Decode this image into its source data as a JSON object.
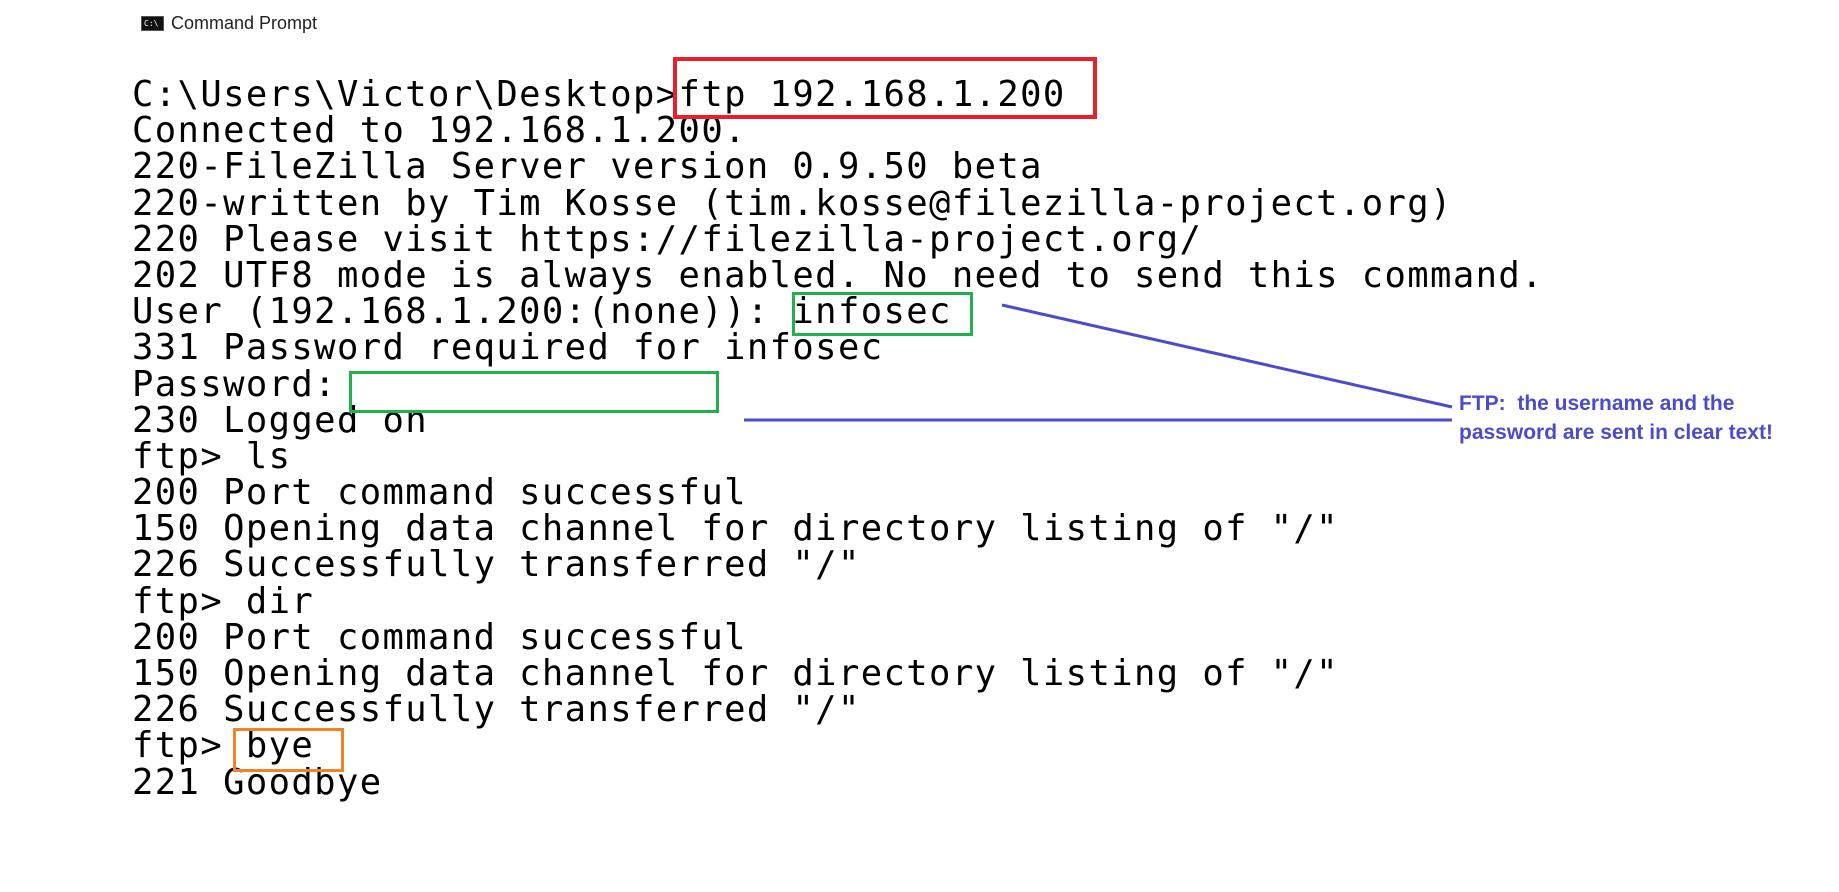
{
  "window": {
    "title": "Command Prompt",
    "icon": "cmd-icon"
  },
  "console": {
    "lines": [
      "C:\\Users\\Victor\\Desktop>ftp 192.168.1.200",
      "Connected to 192.168.1.200.",
      "220-FileZilla Server version 0.9.50 beta",
      "220-written by Tim Kosse (tim.kosse@filezilla-project.org)",
      "220 Please visit https://filezilla-project.org/",
      "202 UTF8 mode is always enabled. No need to send this command.",
      "User (192.168.1.200:(none)): infosec",
      "331 Password required for infosec",
      "Password:",
      "230 Logged on",
      "ftp> ls",
      "200 Port command successful",
      "150 Opening data channel for directory listing of \"/\"",
      "226 Successfully transferred \"/\"",
      "ftp> dir",
      "200 Port command successful",
      "150 Opening data channel for directory listing of \"/\"",
      "226 Successfully transferred \"/\"",
      "ftp> bye",
      "221 Goodbye"
    ]
  },
  "annotation": {
    "line1": "FTP:  the username and the",
    "line2": "password are sent in clear text!",
    "color": "#4a4ccc"
  },
  "highlights": {
    "command_color": "#e8202a",
    "credentials_color": "#22b04c",
    "bye_color": "#f0832a"
  }
}
